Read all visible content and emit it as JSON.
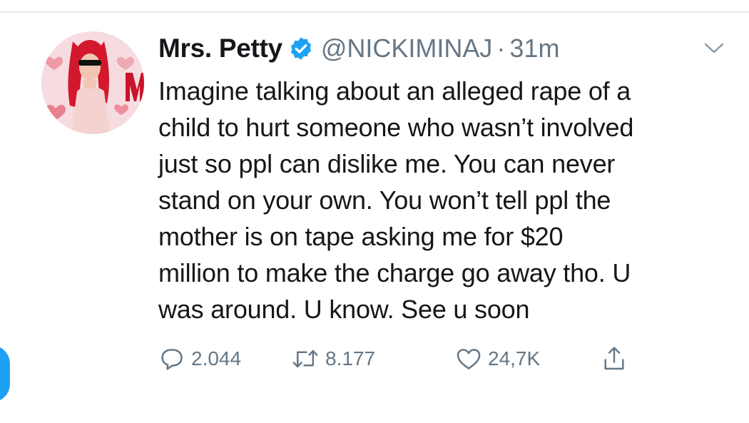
{
  "tweet": {
    "display_name": "Mrs. Petty",
    "handle": "@NICKIMINAJ",
    "separator": "·",
    "time": "31m",
    "text": "Imagine talking about an alleged rape of a\nchild to hurt someone who wasn’t involved\njust so ppl can dislike me. You can never\nstand on your own. You won’t tell ppl the\nmother is on tape asking me for $20\nmillion to make the charge go away tho. U\nwas around. U know. See u soon",
    "counts": {
      "replies": "2.044",
      "retweets": "8.177",
      "likes": "24,7K"
    }
  },
  "icons": {
    "verified": "verified-badge-icon",
    "caret": "chevron-down-icon",
    "reply": "reply-icon",
    "retweet": "retweet-icon",
    "like": "heart-icon",
    "share": "share-icon"
  },
  "colors": {
    "verified": "#1da1f2",
    "text": "#14171a",
    "muted": "#657786",
    "accent": "#1da1f2"
  }
}
